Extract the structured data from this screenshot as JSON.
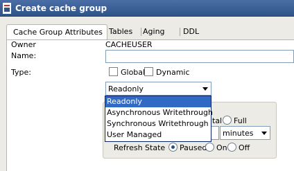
{
  "window": {
    "title": "Create cache group"
  },
  "tabs": [
    {
      "label": "Cache Group Attributes",
      "active": true
    },
    {
      "label": "Tables",
      "active": false
    },
    {
      "label": "Aging",
      "active": false
    },
    {
      "label": "DDL",
      "active": false
    }
  ],
  "form": {
    "owner_label": "Owner",
    "owner_value": "CACHEUSER",
    "name_label": "Name:",
    "name_value": "",
    "type_label": "Type:",
    "global_label": "Global",
    "global_checked": false,
    "dynamic_label": "Dynamic",
    "dynamic_checked": false,
    "type_selected": "Readonly",
    "type_options": [
      "Readonly",
      "Asynchronous Writethrough",
      "Synchronous Writethrough",
      "User Managed"
    ],
    "highlighted_option": "Readonly"
  },
  "refresh": {
    "mode_partial_text": "tal",
    "full_label": "Full",
    "interval_unit": "minutes",
    "state_label": "Refresh State",
    "paused_label": "Paused",
    "on_label": "On",
    "off_label": "Off",
    "state_selected": "Paused"
  },
  "colors": {
    "titlebar": "#2f5488",
    "selection": "#316ac5",
    "panel": "#ecebe6"
  }
}
